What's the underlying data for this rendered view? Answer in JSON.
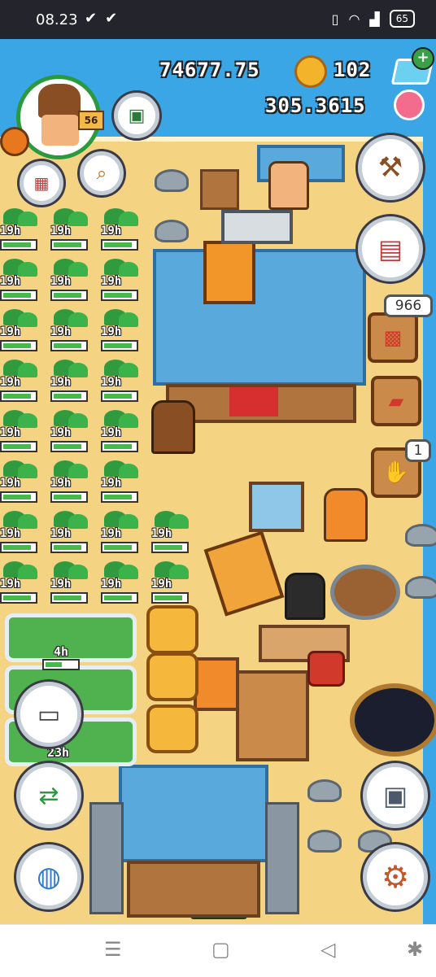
{
  "status_bar": {
    "time": "08.23",
    "left_icons": [
      "check-icon",
      "check-icon"
    ],
    "right_icons": [
      "vibrate-icon",
      "wifi-icon",
      "signal-icon"
    ],
    "battery": "65"
  },
  "hud": {
    "coins": "74677.75",
    "gems": "102",
    "flowers": "305.3615",
    "player_level": "56",
    "storage_count": "966",
    "glove_count": "1",
    "plus_label": "+"
  },
  "fields": {
    "plot_timer": "19h",
    "rows": [
      {
        "count": 3,
        "fills": [
          0.9,
          0.9,
          0.9
        ]
      },
      {
        "count": 3,
        "fills": [
          0.9,
          0.9,
          0.9
        ]
      },
      {
        "count": 3,
        "fills": [
          0.9,
          0.9,
          0.9
        ]
      },
      {
        "count": 3,
        "fills": [
          0.9,
          0.9,
          0.9
        ]
      },
      {
        "count": 3,
        "fills": [
          0.9,
          0.9,
          0.9
        ]
      },
      {
        "count": 3,
        "fills": [
          0.9,
          0.9,
          0.9
        ]
      },
      {
        "count": 4,
        "fills": [
          0.9,
          0.9,
          0.9,
          0.9
        ]
      },
      {
        "count": 4,
        "fills": [
          0.9,
          0.9,
          0.9,
          0.9
        ]
      }
    ],
    "garden_timer_1": "4h",
    "garden_timer_2": "23h"
  },
  "colors": {
    "sea": "#3aa6e6",
    "sand": "#f4d383",
    "progress": "#47b84b",
    "roof": "#5aa9dd"
  },
  "nav": {
    "recents": "☰",
    "home": "▢",
    "back": "◁",
    "accessibility": "✱"
  }
}
